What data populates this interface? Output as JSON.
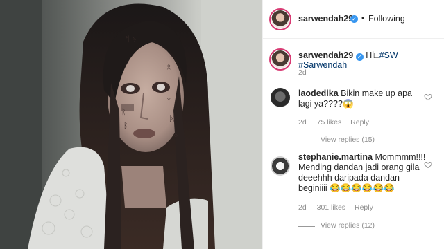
{
  "post": {
    "username": "sarwendah29",
    "follow_status": "Following",
    "caption": {
      "username": "sarwendah29",
      "text_prefix": "Hi",
      "glyph": "□",
      "hashtags": [
        "#SW",
        "#Sarwendah"
      ],
      "age": "2d"
    }
  },
  "comments": [
    {
      "username": "laodedika",
      "text": "Bikin make up apa lagi ya????",
      "emoji": "😱",
      "age": "2d",
      "likes": "75 likes",
      "reply_label": "Reply",
      "view_replies": "View replies (15)"
    },
    {
      "username": "stephanie.martina",
      "text_line1": "Mommmm!!!!",
      "text_line2": "Mending dandan jadi orang gila",
      "text_line3": "deeehhh daripada dandan",
      "text_line4": "beginiiii",
      "emojis": "😂😂😂😂😂😂",
      "age": "2d",
      "likes": "301 likes",
      "reply_label": "Reply",
      "view_replies": "View replies (12)"
    }
  ],
  "icons": {
    "verified": "verified-badge-icon",
    "heart": "heart-icon"
  },
  "colors": {
    "verified": "#3897f0",
    "story_ring": "#d83a73",
    "hashtag": "#003569",
    "meta": "#8e8e8e"
  }
}
